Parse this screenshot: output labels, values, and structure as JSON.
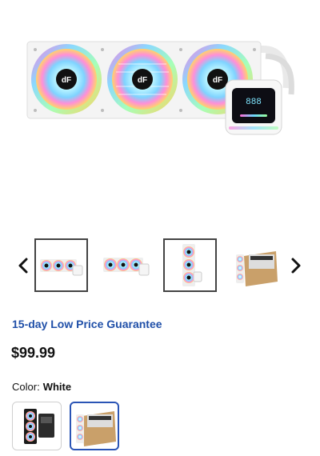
{
  "product_image": {
    "fan_logo_text": "dF",
    "pump_display_text": "888"
  },
  "gallery": {
    "prev_icon": "chevron-left-icon",
    "next_icon": "chevron-right-icon",
    "selected_indices": [
      0,
      2
    ]
  },
  "promo_link": "15-day Low Price Guarantee",
  "price": "$99.99",
  "color": {
    "label": "Color:",
    "value": "White",
    "options_selected_index": 1
  },
  "colors": {
    "accent": "#1f4fa8",
    "selected_swatch": "#2a54b5",
    "selected_thumb": "#444444"
  }
}
